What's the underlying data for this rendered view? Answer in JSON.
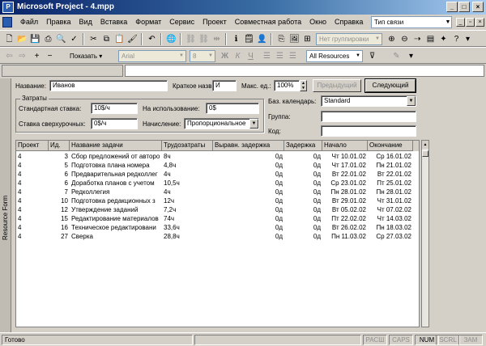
{
  "window": {
    "title": "Microsoft Project - 4.mpp",
    "icon": "project-app-icon"
  },
  "menu": {
    "items": [
      "Файл",
      "Правка",
      "Вид",
      "Вставка",
      "Формат",
      "Сервис",
      "Проект",
      "Совместная работа",
      "Окно",
      "Справка"
    ],
    "help_box": "Тип связи"
  },
  "toolbar1": {
    "group_combo": "Нет группировки"
  },
  "toolbar2": {
    "show_label": "Показать",
    "font_combo": "Arial",
    "size_combo": "8",
    "filter_combo": "All Resources"
  },
  "form": {
    "view_label": "Resource Form",
    "name_label": "Название:",
    "name_value": "Иванов",
    "short_label": "Краткое назв.:",
    "short_value": "И",
    "max_label": "Макс. ед.:",
    "max_value": "100%",
    "prev_button": "Предыдущий",
    "next_button": "Следующий",
    "costs_caption": "Затраты",
    "std_rate_label": "Стандартная ставка:",
    "std_rate_value": "10$/ч",
    "per_use_label": "На использование:",
    "per_use_value": "0$",
    "ovt_rate_label": "Ставка сверхурочных:",
    "ovt_rate_value": "0$/ч",
    "accrue_label": "Начисление:",
    "accrue_value": "Пропорциональное",
    "calendar_label": "Баз. календарь:",
    "calendar_value": "Standard",
    "group_label": "Группа:",
    "group_value": "",
    "code_label": "Код:",
    "code_value": ""
  },
  "grid": {
    "headers": [
      "Проект",
      "Ид.",
      "Название задачи",
      "Трудозатраты",
      "Выравн. задержка",
      "Задержка",
      "Начало",
      "Окончание"
    ],
    "rows": [
      [
        "4",
        "3",
        "Сбор предложений от авторо",
        "8ч",
        "0д",
        "0д",
        "Чт 10.01.02",
        "Ср 16.01.02"
      ],
      [
        "4",
        "5",
        "Подготовка плана номера",
        "4,8ч",
        "0д",
        "0д",
        "Чт 17.01.02",
        "Пн 21.01.02"
      ],
      [
        "4",
        "6",
        "Предварительная редколлег",
        "4ч",
        "0д",
        "0д",
        "Вт 22.01.02",
        "Вт 22.01.02"
      ],
      [
        "4",
        "6",
        "Доработка планов с учетом",
        "10,5ч",
        "0д",
        "0д",
        "Ср 23.01.02",
        "Пт 25.01.02"
      ],
      [
        "4",
        "7",
        "Редколлегия",
        "4ч",
        "0д",
        "0д",
        "Пн 28.01.02",
        "Пн 28.01.02"
      ],
      [
        "4",
        "10",
        "Подготовка редакционных з",
        "12ч",
        "0д",
        "0д",
        "Вт 29.01.02",
        "Чт 31.01.02"
      ],
      [
        "4",
        "12",
        "Утверждение заданий",
        "7,2ч",
        "0д",
        "0д",
        "Вт 05.02.02",
        "Чт 07.02.02"
      ],
      [
        "4",
        "15",
        "Редактирование материалов",
        "74ч",
        "0д",
        "0д",
        "Пт 22.02.02",
        "Чт 14.03.02"
      ],
      [
        "4",
        "16",
        "Техническое редактировани",
        "33,6ч",
        "0д",
        "0д",
        "Вт 26.02.02",
        "Пн 18.03.02"
      ],
      [
        "4",
        "27",
        "Сверка",
        "28,8ч",
        "0д",
        "0д",
        "Пн 11.03.02",
        "Ср 27.03.02"
      ]
    ]
  },
  "status": {
    "text": "Готово",
    "indicators": [
      "РАСШ",
      "CAPS",
      "NUM",
      "SCRL",
      "ЗАМ"
    ],
    "active": "NUM"
  }
}
